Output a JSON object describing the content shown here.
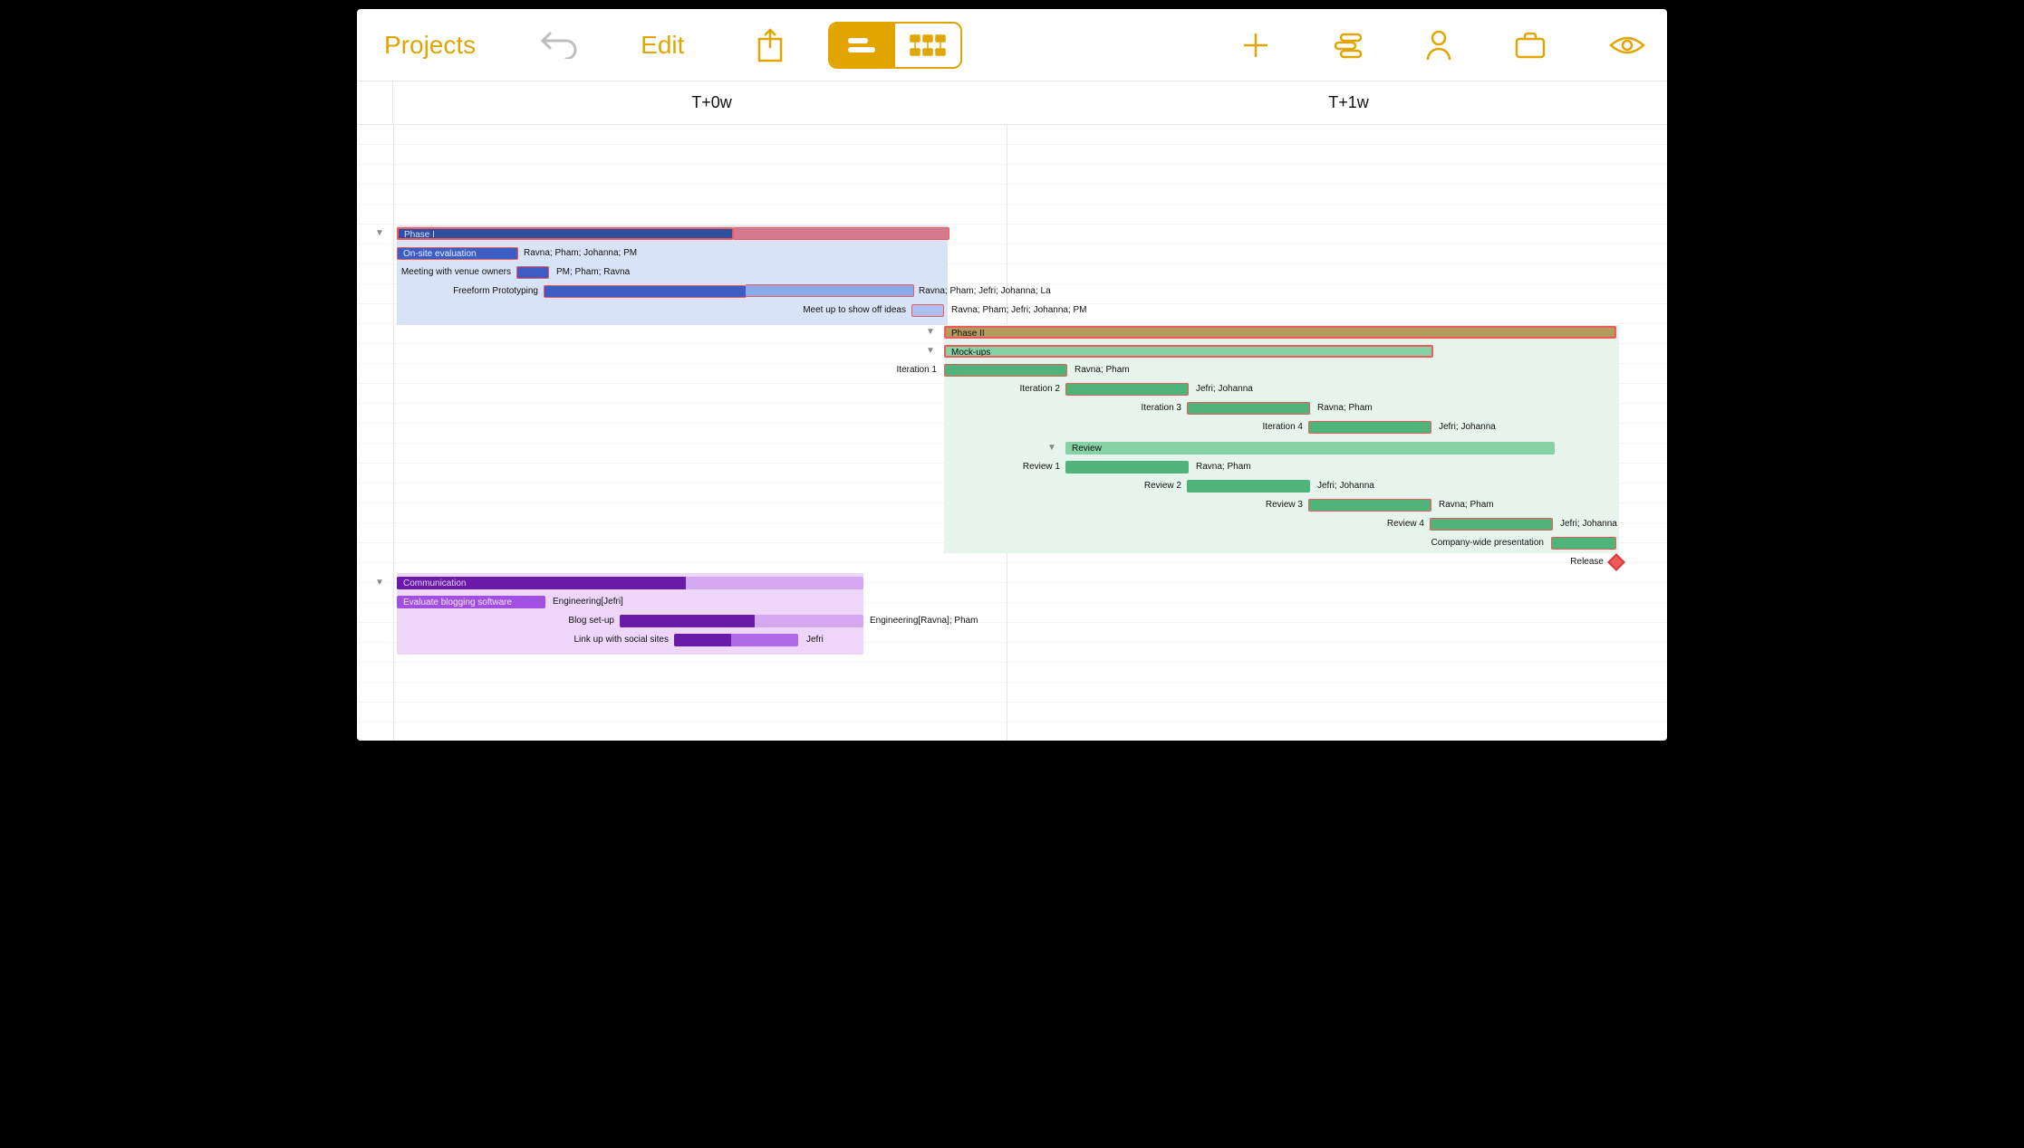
{
  "toolbar": {
    "back_label": "Projects",
    "edit_label": "Edit"
  },
  "timeline": {
    "col0": "T+0w",
    "col1": "T+1w"
  },
  "phase1": {
    "title": "Phase I",
    "onsite": "On-site evaluation",
    "onsite_res": "Ravna; Pham; Johanna; PM",
    "meeting": "Meeting with venue owners",
    "meeting_res": "PM; Pham; Ravna",
    "proto": "Freeform Prototyping",
    "proto_res": "Ravna; Pham; Jefri; Johanna; La",
    "meetup": "Meet up to show off ideas",
    "meetup_res": "Ravna; Pham; Jefri; Johanna; PM"
  },
  "phase2": {
    "title": "Phase II",
    "mockups": "Mock-ups",
    "it1": "Iteration 1",
    "it1_res": "Ravna; Pham",
    "it2": "Iteration 2",
    "it2_res": "Jefri; Johanna",
    "it3": "Iteration 3",
    "it3_res": "Ravna; Pham",
    "it4": "Iteration 4",
    "it4_res": "Jefri; Johanna",
    "review": "Review",
    "rv1": "Review 1",
    "rv1_res": "Ravna; Pham",
    "rv2": "Review 2",
    "rv2_res": "Jefri; Johanna",
    "rv3": "Review 3",
    "rv3_res": "Ravna; Pham",
    "rv4": "Review 4",
    "rv4_res": "Jefri; Johanna",
    "pres": "Company-wide presentation",
    "release": "Release"
  },
  "comm": {
    "title": "Communication",
    "eval": "Evaluate blogging software",
    "eval_res": "Engineering[Jefri]",
    "blog": "Blog set-up",
    "blog_res": "Engineering[Ravna]; Pham",
    "social": "Link up with social sites",
    "social_res": "Jefri"
  }
}
